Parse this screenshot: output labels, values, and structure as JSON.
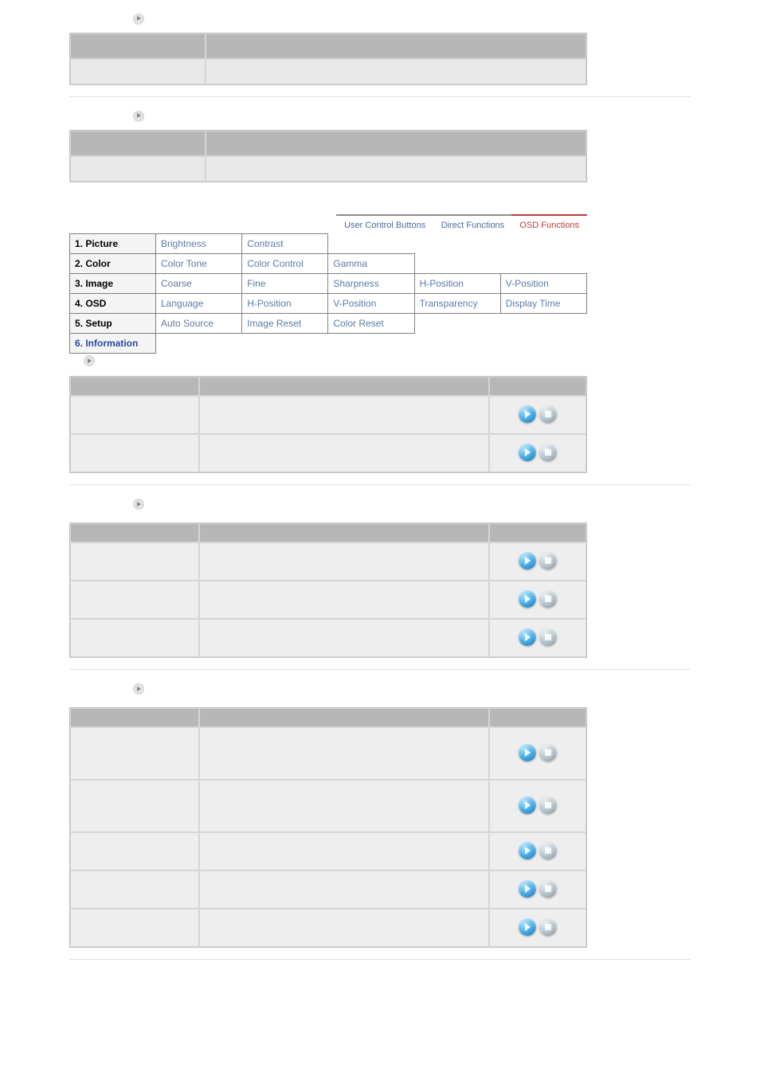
{
  "tabs": {
    "user_control": "User Control Buttons",
    "direct_functions": "Direct Functions",
    "osd_functions": "OSD Functions"
  },
  "matrix": {
    "rows": [
      {
        "cat": "1. Picture",
        "cells": [
          "Brightness",
          "Contrast",
          "",
          "",
          ""
        ]
      },
      {
        "cat": "2. Color",
        "cells": [
          "Color Tone",
          "Color Control",
          "Gamma",
          "",
          ""
        ]
      },
      {
        "cat": "3. Image",
        "cells": [
          "Coarse",
          "Fine",
          "Sharpness",
          "H-Position",
          "V-Position"
        ]
      },
      {
        "cat": "4. OSD",
        "cells": [
          "Language",
          "H-Position",
          "V-Position",
          "Transparency",
          "Display Time"
        ]
      },
      {
        "cat": "5. Setup",
        "cells": [
          "Auto Source",
          "Image Reset",
          "Color Reset",
          "",
          ""
        ]
      },
      {
        "cat": "6. Information",
        "selected": true,
        "cells": [
          "",
          "",
          "",
          "",
          ""
        ]
      }
    ]
  },
  "media_sections": [
    {
      "rows": 2,
      "tall": []
    },
    {
      "rows": 3,
      "tall": []
    },
    {
      "rows": 5,
      "tall": [
        0,
        1
      ]
    }
  ]
}
